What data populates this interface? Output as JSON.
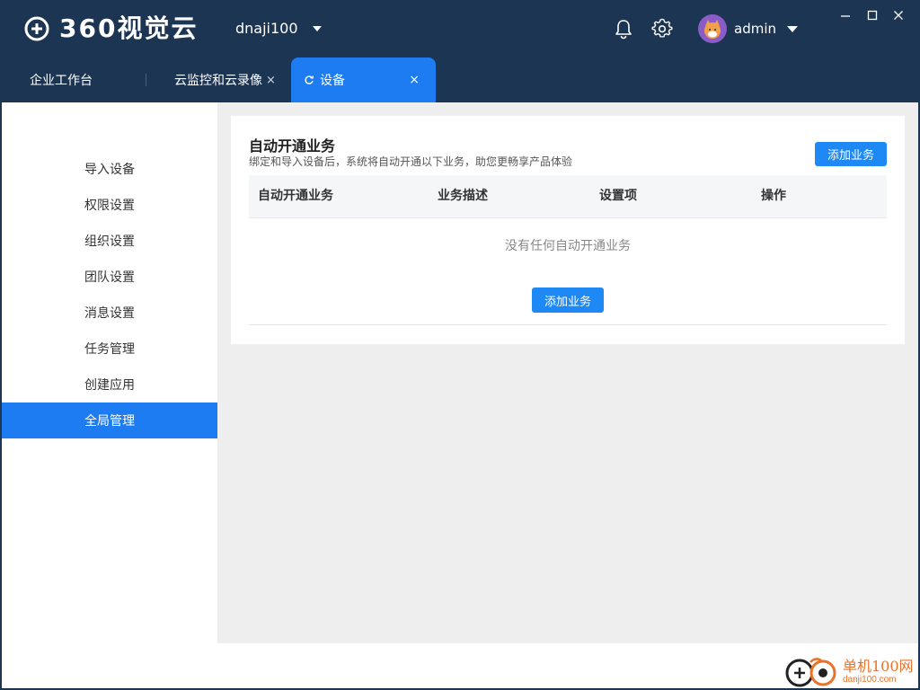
{
  "app": {
    "logo_text": "360视觉云"
  },
  "header": {
    "account_name": "dnaji100",
    "user_name": "admin"
  },
  "tabs": [
    {
      "label": "企业工作台"
    },
    {
      "label": "云监控和云录像",
      "close": "×"
    },
    {
      "label": "设备",
      "close": "×"
    }
  ],
  "sidebar": {
    "items": [
      {
        "label": "导入设备"
      },
      {
        "label": "权限设置"
      },
      {
        "label": "组织设置"
      },
      {
        "label": "团队设置"
      },
      {
        "label": "消息设置"
      },
      {
        "label": "任务管理"
      },
      {
        "label": "创建应用"
      },
      {
        "label": "全局管理",
        "active": true
      }
    ]
  },
  "main": {
    "title": "自动开通业务",
    "subtitle": "绑定和导入设备后，系统将自动开通以下业务，助您更畅享产品体验",
    "add_button": "添加业务",
    "columns": [
      "自动开通业务",
      "业务描述",
      "设置项",
      "操作"
    ],
    "empty_text": "没有任何自动开通业务",
    "empty_add_button": "添加业务"
  },
  "watermark": {
    "cn": "单机100网",
    "en": "danji100.com"
  },
  "colors": {
    "header_bg": "#1c3553",
    "accent": "#1e7cf2",
    "button": "#1e88f5"
  },
  "icons": [
    "logo-icon",
    "caret-down-icon",
    "bell-icon",
    "gear-icon",
    "avatar-icon",
    "minimize-icon",
    "maximize-icon",
    "close-icon",
    "refresh-icon"
  ]
}
